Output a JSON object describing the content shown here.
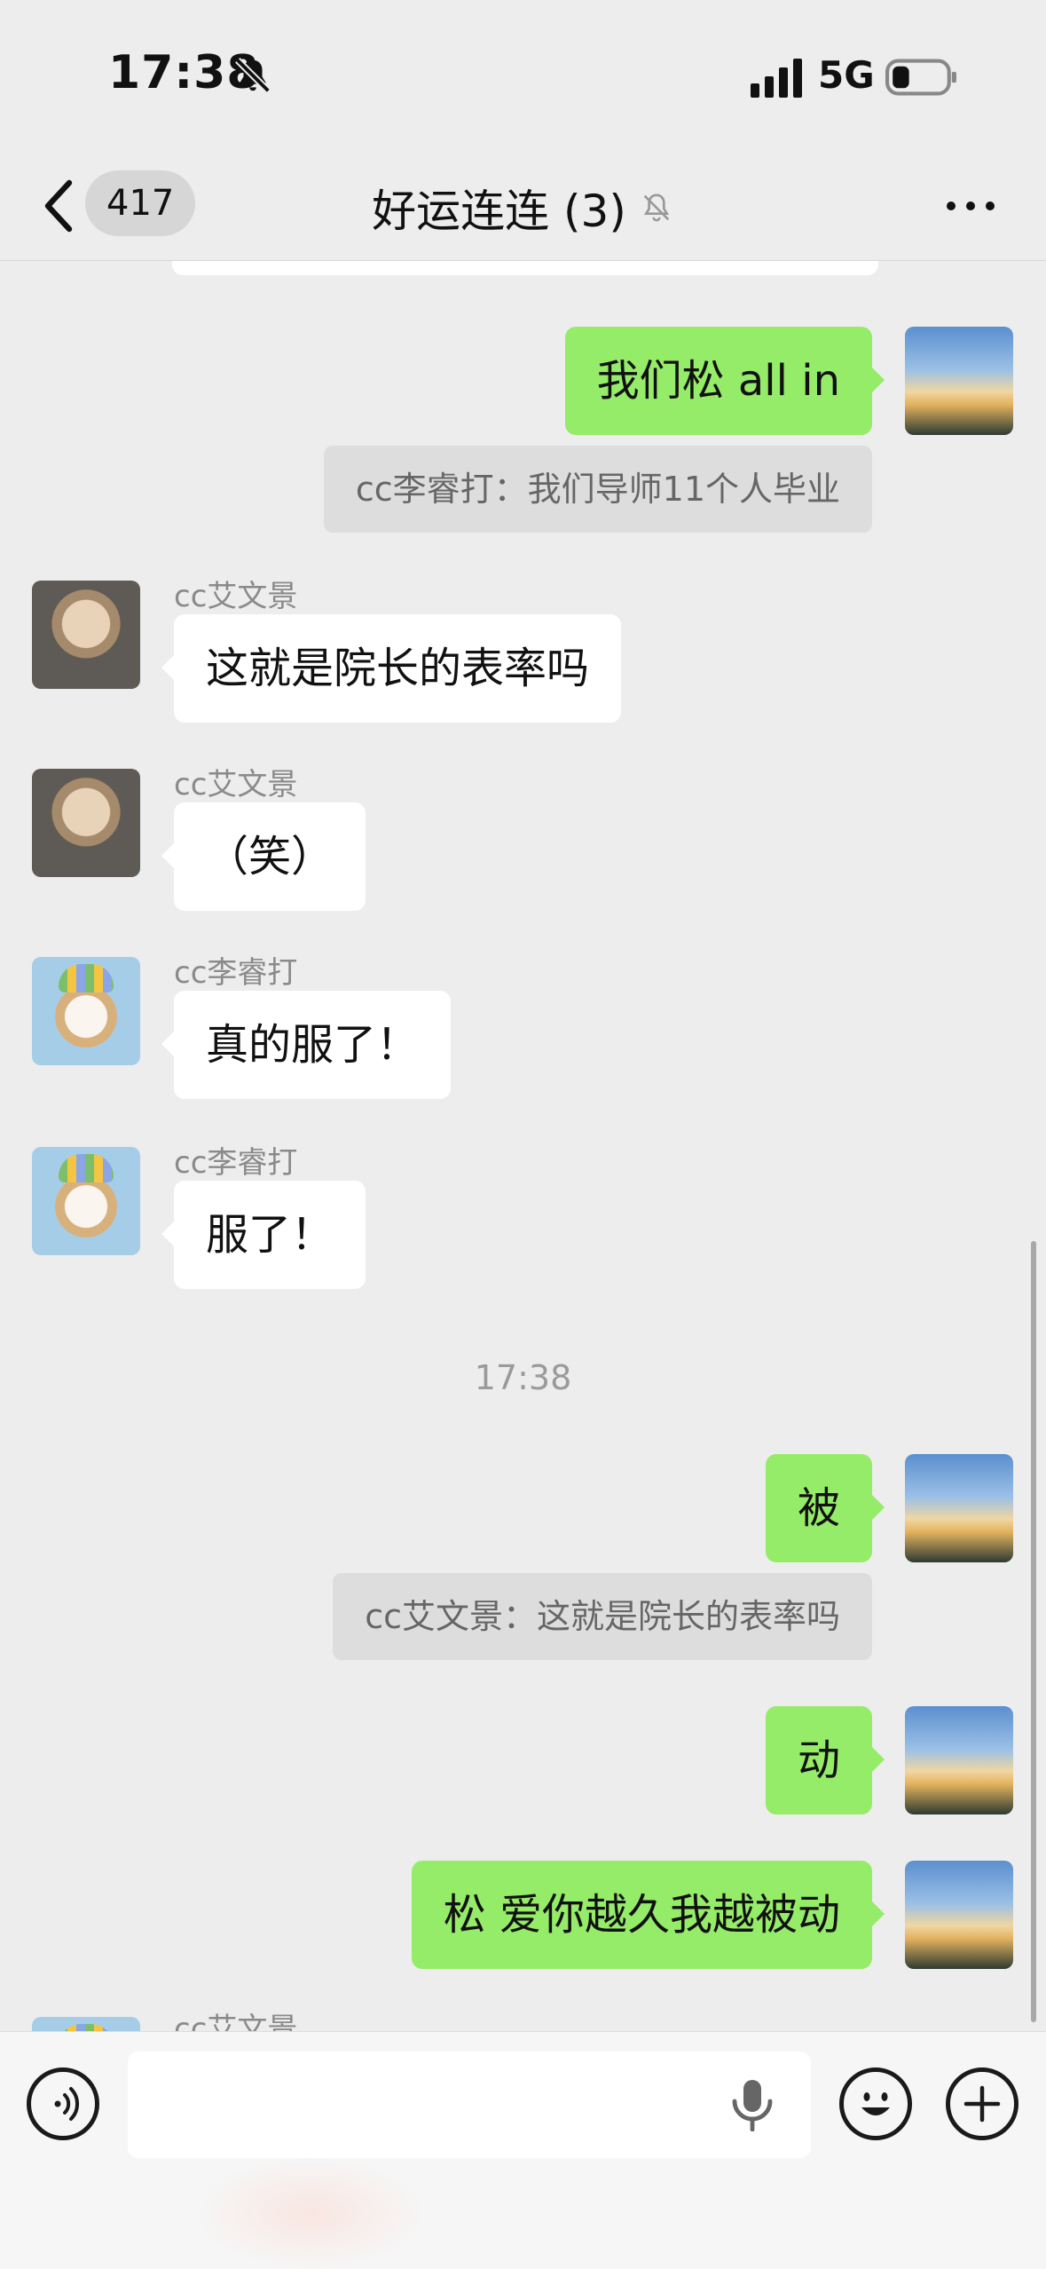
{
  "status_bar": {
    "time": "17:38",
    "network": "5G"
  },
  "header": {
    "unread_count": "417",
    "title": "好运连连 (3)"
  },
  "messages": [
    {
      "type": "out",
      "text": "我们松 all in"
    },
    {
      "type": "quote",
      "text": "cc李睿打：我们导师11个人毕业"
    },
    {
      "type": "in",
      "sender": "cc艾文景",
      "text": "这就是院长的表率吗"
    },
    {
      "type": "in",
      "sender": "cc艾文景",
      "text": "（笑）"
    },
    {
      "type": "in",
      "sender": "cc李睿打",
      "text": "真的服了！"
    },
    {
      "type": "in",
      "sender": "cc李睿打",
      "text": "服了！"
    },
    {
      "type": "time",
      "text": "17:38"
    },
    {
      "type": "out",
      "text": "被"
    },
    {
      "type": "quote",
      "text": "cc艾文景：这就是院长的表率吗"
    },
    {
      "type": "out",
      "text": "动"
    },
    {
      "type": "out",
      "text": "松 爱你越久我越被动"
    },
    {
      "type": "in_partial",
      "sender": "cc艾文景"
    }
  ],
  "input": {
    "value": ""
  },
  "colors": {
    "background": "#ededed",
    "outgoing_bubble": "#95ec69",
    "incoming_bubble": "#ffffff",
    "quote_background": "#dddddd"
  }
}
